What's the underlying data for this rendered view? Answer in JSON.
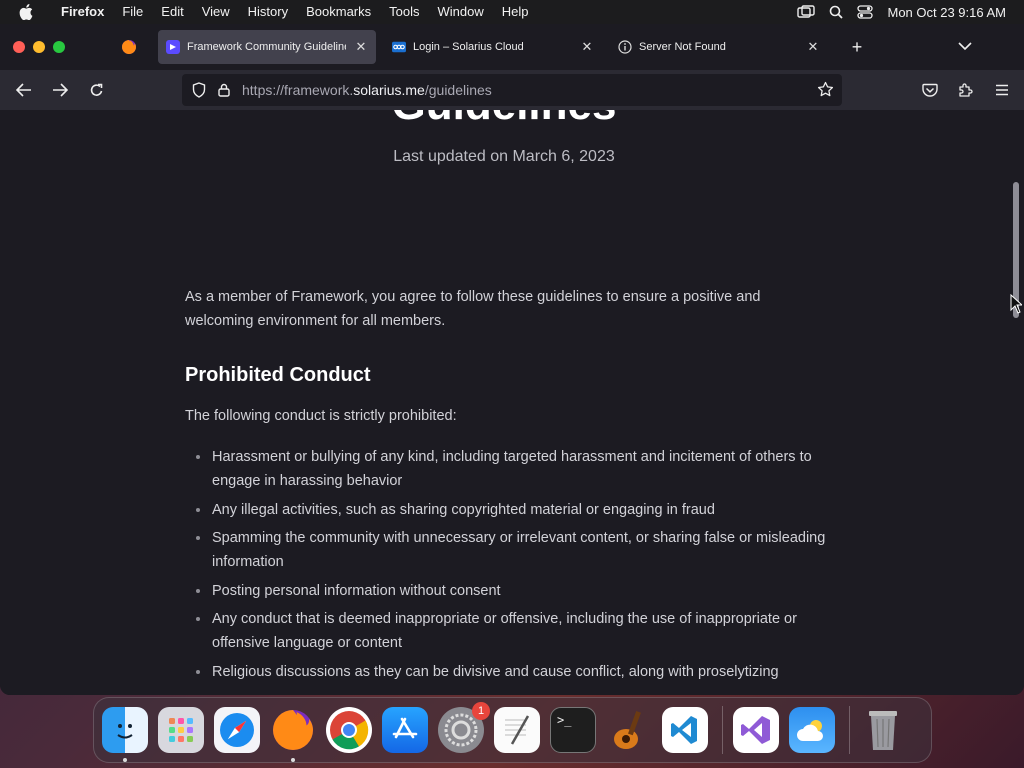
{
  "menubar": {
    "app": "Firefox",
    "items": [
      "File",
      "Edit",
      "View",
      "History",
      "Bookmarks",
      "Tools",
      "Window",
      "Help"
    ],
    "clock": "Mon Oct 23  9:16 AM"
  },
  "tabs": [
    {
      "title": "Framework Community Guidelines",
      "active": true
    },
    {
      "title": "Login – Solarius Cloud",
      "active": false
    },
    {
      "title": "Server Not Found",
      "active": false
    }
  ],
  "url": {
    "prefix": "https://framework.",
    "domain": "solarius.me",
    "path": "/guidelines"
  },
  "page": {
    "title": "Guidelines",
    "updated": "Last updated on March 6, 2023",
    "intro": "As a member of Framework, you agree to follow these guidelines to ensure a positive and welcoming environment for all members.",
    "section_heading": "Prohibited Conduct",
    "lead": "The following conduct is strictly prohibited:",
    "rules": [
      "Harassment or bullying of any kind, including targeted harassment and incitement of others to engage in harassing behavior",
      "Any illegal activities, such as sharing copyrighted material or engaging in fraud",
      "Spamming the community with unnecessary or irrelevant content, or sharing false or misleading information",
      "Posting personal information without consent",
      "Any conduct that is deemed inappropriate or offensive, including the use of inappropriate or offensive language or content",
      "Religious discussions as they can be divisive and cause conflict, along with proselytizing"
    ]
  },
  "dock": {
    "apps": [
      "Finder",
      "Launchpad",
      "Safari",
      "Firefox",
      "Chrome",
      "App Store",
      "System Settings",
      "TextEdit",
      "Terminal",
      "GarageBand",
      "VS Code",
      "Visual Studio",
      "Weather",
      "Trash"
    ],
    "settings_badge": "1"
  },
  "colors": {
    "accent": "#0060df",
    "page_bg": "#1c1b22"
  }
}
